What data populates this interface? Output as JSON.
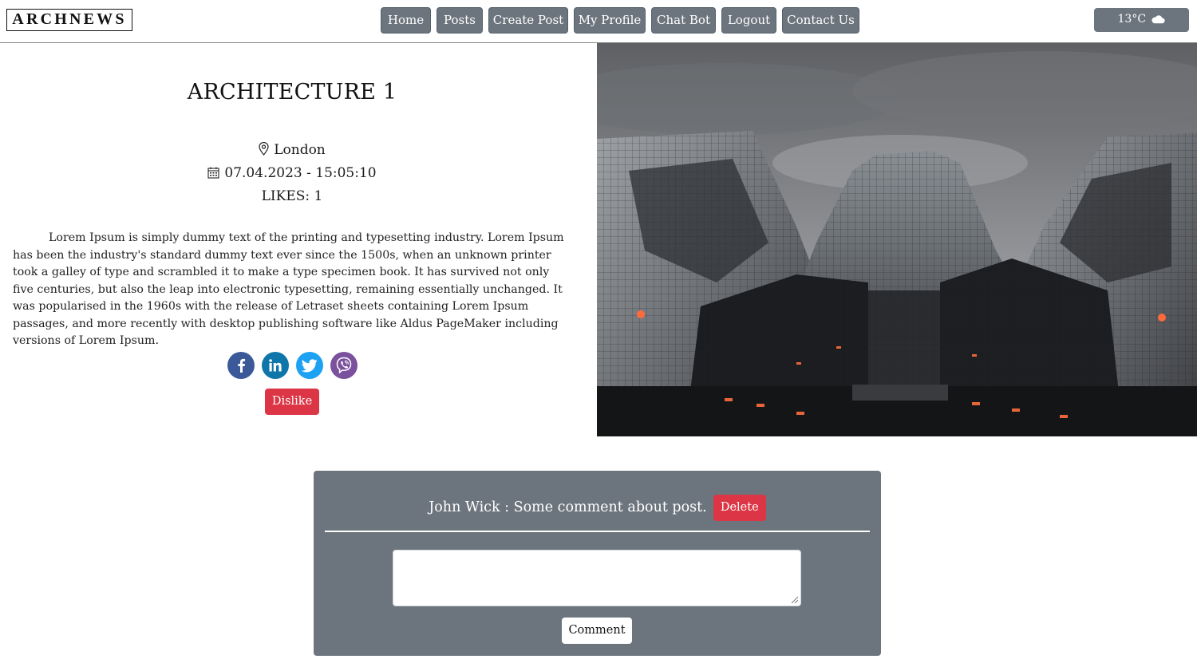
{
  "header": {
    "logo": "ARCHNEWS",
    "nav": [
      "Home",
      "Posts",
      "Create Post",
      "My Profile",
      "Chat Bot",
      "Logout",
      "Contact Us"
    ],
    "weather": {
      "temp": "13°C",
      "icon": "cloud-icon"
    }
  },
  "post": {
    "title": "ARCHITECTURE 1",
    "location": "London",
    "datetime": "07.04.2023 - 15:05:10",
    "likes": "LIKES: 1",
    "body": "Lorem Ipsum is simply dummy text of the printing and typesetting industry. Lorem Ipsum has been the industry's standard dummy text ever since the 1500s, when an unknown printer took a galley of type and scrambled it to make a type specimen book. It has survived not only five centuries, but also the leap into electronic typesetting, remaining essentially unchanged. It was popularised in the 1960s with the release of Letraset sheets containing Lorem Ipsum passages, and more recently with desktop publishing software like Aldus PageMaker including versions of Lorem Ipsum.",
    "share": [
      {
        "icon": "facebook-icon",
        "color": "#3b5998"
      },
      {
        "icon": "linkedin-icon",
        "color": "#0e76a8"
      },
      {
        "icon": "twitter-icon",
        "color": "#1da1f2"
      },
      {
        "icon": "viber-icon",
        "color": "#7b519d"
      }
    ],
    "dislike_label": "Dislike",
    "image_icon": "building-photo"
  },
  "comments": {
    "items": [
      {
        "text": "John Wick : Some comment about post.",
        "delete_label": "Delete"
      }
    ],
    "input_value": "",
    "submit_label": "Comment"
  },
  "colors": {
    "secondary": "#6c757d",
    "danger": "#dc3545"
  }
}
